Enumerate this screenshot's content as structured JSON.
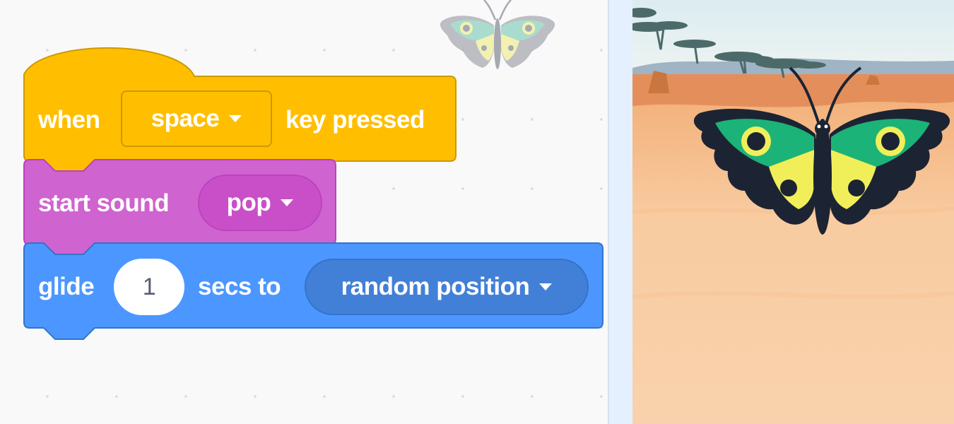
{
  "script": {
    "hat_block": {
      "prefix": "when",
      "key": "space",
      "suffix": "key pressed",
      "color": "#ffbf00"
    },
    "sound_block": {
      "label": "start sound",
      "sound": "pop",
      "color": "#cf63cf"
    },
    "motion_block": {
      "label": "glide",
      "secs": "1",
      "mid_label": "secs to",
      "target": "random position",
      "color": "#4c97ff"
    }
  },
  "ghost_sprite": {
    "icon": "butterfly-icon"
  },
  "stage": {
    "backdrop": "savanna",
    "sprite": {
      "icon": "butterfly-icon"
    }
  },
  "colors": {
    "events": "#ffbf00",
    "sound": "#cf63cf",
    "motion": "#4c97ff",
    "divider": "#e5f0ff"
  }
}
